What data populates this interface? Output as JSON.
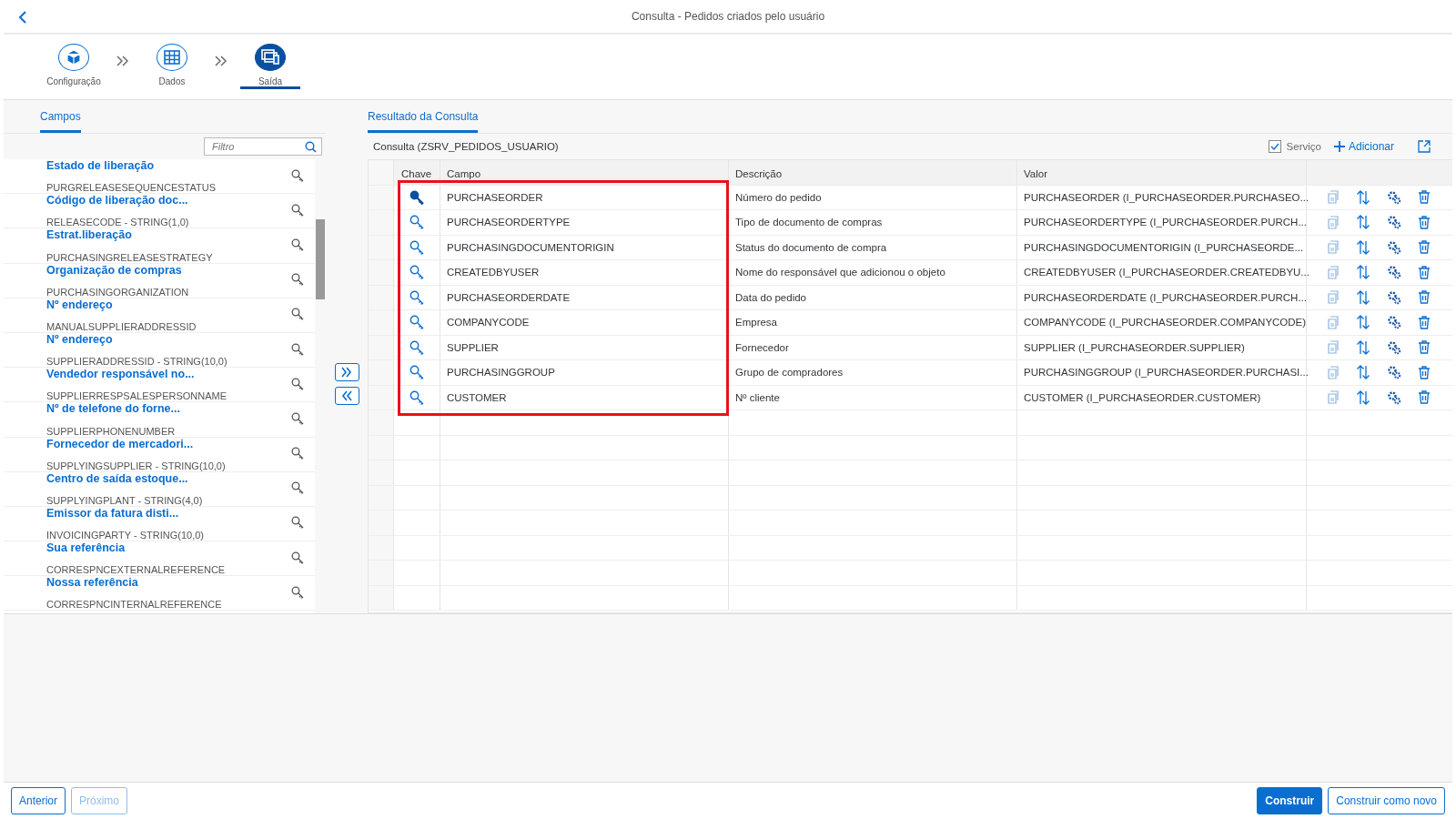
{
  "header": {
    "title": "Consulta - Pedidos criados pelo usuário"
  },
  "steps": [
    {
      "label": "Configuração",
      "selected": false
    },
    {
      "label": "Dados",
      "selected": false
    },
    {
      "label": "Saída",
      "selected": true
    }
  ],
  "left_panel": {
    "tab": {
      "label": "Campos",
      "selected": true
    },
    "filter": {
      "placeholder": "Filtro"
    },
    "fields": [
      {
        "label": "Estado de liberação",
        "technical": "PURGRELEASESEQUENCESTATUS"
      },
      {
        "label": "Código de liberação doc...",
        "technical": "RELEASECODE - STRING(1,0)"
      },
      {
        "label": "Estrat.liberação",
        "technical": "PURCHASINGRELEASESTRATEGY"
      },
      {
        "label": "Organização de compras",
        "technical": "PURCHASINGORGANIZATION"
      },
      {
        "label": "Nº endereço",
        "technical": "MANUALSUPPLIERADDRESSID"
      },
      {
        "label": "Nº endereço",
        "technical": "SUPPLIERADDRESSID - STRING(10,0)"
      },
      {
        "label": "Vendedor responsável no...",
        "technical": "SUPPLIERRESPSALESPERSONNAME"
      },
      {
        "label": "Nº de telefone do forne...",
        "technical": "SUPPLIERPHONENUMBER"
      },
      {
        "label": "Fornecedor de mercadori...",
        "technical": "SUPPLYINGSUPPLIER - STRING(10,0)"
      },
      {
        "label": "Centro de saída estoque...",
        "technical": "SUPPLYINGPLANT - STRING(4,0)"
      },
      {
        "label": "Emissor da fatura disti...",
        "technical": "INVOICINGPARTY - STRING(10,0)"
      },
      {
        "label": "Sua referência",
        "technical": "CORRESPNCEXTERNALREFERENCE"
      },
      {
        "label": "Nossa referência",
        "technical": "CORRESPNCINTERNALREFERENCE"
      }
    ]
  },
  "right_panel": {
    "tab": {
      "label": "Resultado da Consulta",
      "selected": true
    },
    "title": "Consulta (ZSRV_PEDIDOS_USUARIO)",
    "service": {
      "label": "Serviço",
      "checked": true
    },
    "add_button": "Adicionar",
    "columns": [
      "Chave",
      "Campo",
      "Descrição",
      "Valor"
    ],
    "rows": [
      {
        "key": true,
        "field": "PURCHASEORDER",
        "description": "Número do pedido",
        "value": "PURCHASEORDER (I_PURCHASEORDER.PURCHASEO..."
      },
      {
        "key": false,
        "field": "PURCHASEORDERTYPE",
        "description": "Tipo de documento de compras",
        "value": "PURCHASEORDERTYPE (I_PURCHASEORDER.PURCH..."
      },
      {
        "key": false,
        "field": "PURCHASINGDOCUMENTORIGIN",
        "description": "Status do documento de compra",
        "value": "PURCHASINGDOCUMENTORIGIN (I_PURCHASEORDE..."
      },
      {
        "key": false,
        "field": "CREATEDBYUSER",
        "description": "Nome do responsável que adicionou o objeto",
        "value": "CREATEDBYUSER (I_PURCHASEORDER.CREATEDBYU..."
      },
      {
        "key": false,
        "field": "PURCHASEORDERDATE",
        "description": "Data do pedido",
        "value": "PURCHASEORDERDATE (I_PURCHASEORDER.PURCH..."
      },
      {
        "key": false,
        "field": "COMPANYCODE",
        "description": "Empresa",
        "value": "COMPANYCODE (I_PURCHASEORDER.COMPANYCODE)"
      },
      {
        "key": false,
        "field": "SUPPLIER",
        "description": "Fornecedor",
        "value": "SUPPLIER (I_PURCHASEORDER.SUPPLIER)"
      },
      {
        "key": false,
        "field": "PURCHASINGGROUP",
        "description": "Grupo de compradores",
        "value": "PURCHASINGGROUP (I_PURCHASEORDER.PURCHASI..."
      },
      {
        "key": false,
        "field": "CUSTOMER",
        "description": "Nº cliente",
        "value": "CUSTOMER (I_PURCHASEORDER.CUSTOMER)"
      }
    ]
  },
  "footer": {
    "buttons": [
      {
        "label": "Anterior",
        "kind": "secondary",
        "disabled": false
      },
      {
        "label": "Próximo",
        "kind": "secondary",
        "disabled": true
      }
    ],
    "actions": [
      {
        "label": "Construir",
        "kind": "primary",
        "disabled": false
      },
      {
        "label": "Construir como novo",
        "kind": "secondary",
        "disabled": false
      }
    ]
  }
}
